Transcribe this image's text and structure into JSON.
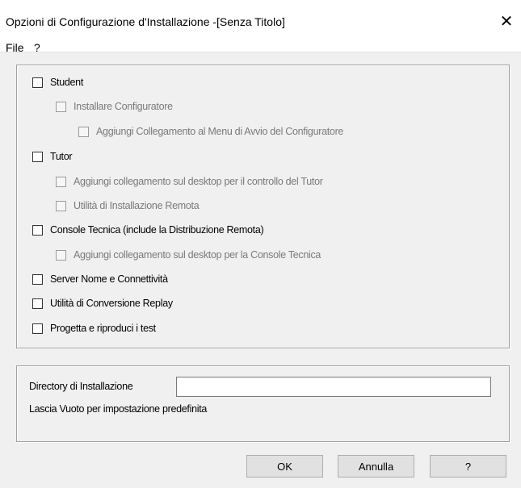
{
  "window": {
    "title": "Opzioni di Configurazione d'Installazione -[Senza Titolo]"
  },
  "icons": {
    "close": "close-icon"
  },
  "menu": {
    "file": "File",
    "help": "?"
  },
  "options": {
    "student": "Student",
    "install_configurator": "Installare Configuratore",
    "add_start_menu_link": "Aggiungi Collegamento al Menu di Avvio del Configuratore",
    "tutor": "Tutor",
    "tutor_desktop_link": "Aggiungi collegamento sul desktop per il controllo del Tutor",
    "remote_install_utility": "Utilità di Installazione Remota",
    "tech_console": "Console Tecnica (include la Distribuzione Remota)",
    "tech_console_desktop_link": "Aggiungi collegamento sul desktop per la Console Tecnica",
    "name_server": "Server Nome e Connettività",
    "replay_conversion": "Utilità di Conversione Replay",
    "design_tests": "Progetta e riproduci i test"
  },
  "install_dir": {
    "label": "Directory di Installazione",
    "value": "",
    "hint": "Lascia Vuoto per impostazione predefinita"
  },
  "buttons": {
    "ok": "OK",
    "cancel": "Annulla",
    "help": "?"
  }
}
